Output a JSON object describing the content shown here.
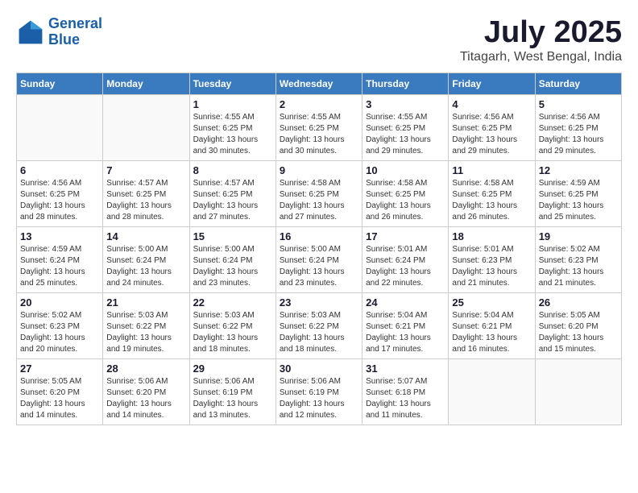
{
  "logo": {
    "name1": "General",
    "name2": "Blue"
  },
  "title": "July 2025",
  "subtitle": "Titagarh, West Bengal, India",
  "days_of_week": [
    "Sunday",
    "Monday",
    "Tuesday",
    "Wednesday",
    "Thursday",
    "Friday",
    "Saturday"
  ],
  "weeks": [
    [
      {
        "day": "",
        "info": ""
      },
      {
        "day": "",
        "info": ""
      },
      {
        "day": "1",
        "info": "Sunrise: 4:55 AM\nSunset: 6:25 PM\nDaylight: 13 hours and 30 minutes."
      },
      {
        "day": "2",
        "info": "Sunrise: 4:55 AM\nSunset: 6:25 PM\nDaylight: 13 hours and 30 minutes."
      },
      {
        "day": "3",
        "info": "Sunrise: 4:55 AM\nSunset: 6:25 PM\nDaylight: 13 hours and 29 minutes."
      },
      {
        "day": "4",
        "info": "Sunrise: 4:56 AM\nSunset: 6:25 PM\nDaylight: 13 hours and 29 minutes."
      },
      {
        "day": "5",
        "info": "Sunrise: 4:56 AM\nSunset: 6:25 PM\nDaylight: 13 hours and 29 minutes."
      }
    ],
    [
      {
        "day": "6",
        "info": "Sunrise: 4:56 AM\nSunset: 6:25 PM\nDaylight: 13 hours and 28 minutes."
      },
      {
        "day": "7",
        "info": "Sunrise: 4:57 AM\nSunset: 6:25 PM\nDaylight: 13 hours and 28 minutes."
      },
      {
        "day": "8",
        "info": "Sunrise: 4:57 AM\nSunset: 6:25 PM\nDaylight: 13 hours and 27 minutes."
      },
      {
        "day": "9",
        "info": "Sunrise: 4:58 AM\nSunset: 6:25 PM\nDaylight: 13 hours and 27 minutes."
      },
      {
        "day": "10",
        "info": "Sunrise: 4:58 AM\nSunset: 6:25 PM\nDaylight: 13 hours and 26 minutes."
      },
      {
        "day": "11",
        "info": "Sunrise: 4:58 AM\nSunset: 6:25 PM\nDaylight: 13 hours and 26 minutes."
      },
      {
        "day": "12",
        "info": "Sunrise: 4:59 AM\nSunset: 6:25 PM\nDaylight: 13 hours and 25 minutes."
      }
    ],
    [
      {
        "day": "13",
        "info": "Sunrise: 4:59 AM\nSunset: 6:24 PM\nDaylight: 13 hours and 25 minutes."
      },
      {
        "day": "14",
        "info": "Sunrise: 5:00 AM\nSunset: 6:24 PM\nDaylight: 13 hours and 24 minutes."
      },
      {
        "day": "15",
        "info": "Sunrise: 5:00 AM\nSunset: 6:24 PM\nDaylight: 13 hours and 23 minutes."
      },
      {
        "day": "16",
        "info": "Sunrise: 5:00 AM\nSunset: 6:24 PM\nDaylight: 13 hours and 23 minutes."
      },
      {
        "day": "17",
        "info": "Sunrise: 5:01 AM\nSunset: 6:24 PM\nDaylight: 13 hours and 22 minutes."
      },
      {
        "day": "18",
        "info": "Sunrise: 5:01 AM\nSunset: 6:23 PM\nDaylight: 13 hours and 21 minutes."
      },
      {
        "day": "19",
        "info": "Sunrise: 5:02 AM\nSunset: 6:23 PM\nDaylight: 13 hours and 21 minutes."
      }
    ],
    [
      {
        "day": "20",
        "info": "Sunrise: 5:02 AM\nSunset: 6:23 PM\nDaylight: 13 hours and 20 minutes."
      },
      {
        "day": "21",
        "info": "Sunrise: 5:03 AM\nSunset: 6:22 PM\nDaylight: 13 hours and 19 minutes."
      },
      {
        "day": "22",
        "info": "Sunrise: 5:03 AM\nSunset: 6:22 PM\nDaylight: 13 hours and 18 minutes."
      },
      {
        "day": "23",
        "info": "Sunrise: 5:03 AM\nSunset: 6:22 PM\nDaylight: 13 hours and 18 minutes."
      },
      {
        "day": "24",
        "info": "Sunrise: 5:04 AM\nSunset: 6:21 PM\nDaylight: 13 hours and 17 minutes."
      },
      {
        "day": "25",
        "info": "Sunrise: 5:04 AM\nSunset: 6:21 PM\nDaylight: 13 hours and 16 minutes."
      },
      {
        "day": "26",
        "info": "Sunrise: 5:05 AM\nSunset: 6:20 PM\nDaylight: 13 hours and 15 minutes."
      }
    ],
    [
      {
        "day": "27",
        "info": "Sunrise: 5:05 AM\nSunset: 6:20 PM\nDaylight: 13 hours and 14 minutes."
      },
      {
        "day": "28",
        "info": "Sunrise: 5:06 AM\nSunset: 6:20 PM\nDaylight: 13 hours and 14 minutes."
      },
      {
        "day": "29",
        "info": "Sunrise: 5:06 AM\nSunset: 6:19 PM\nDaylight: 13 hours and 13 minutes."
      },
      {
        "day": "30",
        "info": "Sunrise: 5:06 AM\nSunset: 6:19 PM\nDaylight: 13 hours and 12 minutes."
      },
      {
        "day": "31",
        "info": "Sunrise: 5:07 AM\nSunset: 6:18 PM\nDaylight: 13 hours and 11 minutes."
      },
      {
        "day": "",
        "info": ""
      },
      {
        "day": "",
        "info": ""
      }
    ]
  ]
}
